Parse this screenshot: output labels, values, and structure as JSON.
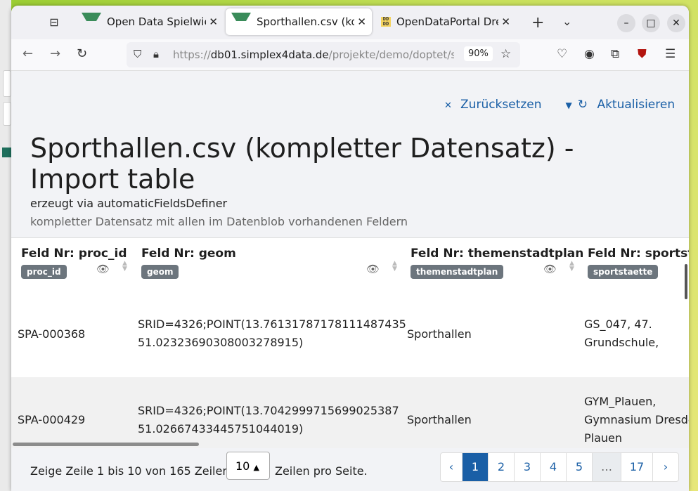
{
  "browser": {
    "tabs": [
      {
        "title": "Open Data Spielwiese",
        "icon": "green-triangle-favicon"
      },
      {
        "title": "Sporthallen.csv (kompl",
        "icon": "green-triangle-favicon"
      },
      {
        "title": "OpenDataPortal Dresd",
        "icon": "dd-favicon"
      }
    ],
    "url_prefix": "https://",
    "url_host": "db01.simplex4data.de",
    "url_path": "/projekte/demo/doptet/s",
    "zoom": "90%"
  },
  "page": {
    "actions": {
      "reset": "Zurücksetzen",
      "refresh": "Aktualisieren"
    },
    "title": "Sporthallen.csv (kompletter Datensatz) - Import table",
    "subtitle": "erzeugt via automaticFieldsDefiner",
    "description": "kompletter Datensatz mit allen im Datenblob vorhandenen Feldern"
  },
  "table": {
    "columns": [
      {
        "label": "Feld Nr: proc_id",
        "badge": "proc_id"
      },
      {
        "label": "Feld Nr: geom",
        "badge": "geom"
      },
      {
        "label": "Feld Nr: themenstadtplan",
        "badge": "themenstadtplan"
      },
      {
        "label": "Feld Nr: sportstae",
        "badge": "sportstaette"
      }
    ],
    "rows": [
      {
        "proc_id": "SPA-000368",
        "geom1": "SRID=4326;POINT(13.76131787178111487435",
        "geom2": "51.02323690308003278915)",
        "themen": "Sporthallen",
        "sport1": "GS_047, 47.",
        "sport2": "Grundschule,",
        "sport3": ""
      },
      {
        "proc_id": "SPA-000429",
        "geom1": "SRID=4326;POINT(13.7042999715699025387",
        "geom2": "51.02667433445751044019)",
        "themen": "Sporthallen",
        "sport1": "GYM_Plauen,",
        "sport2": "Gymnasium Dresde",
        "sport3": "Plauen"
      }
    ]
  },
  "footer": {
    "showing": "Zeige Zeile 1 bis 10 von 165 Zeilen.",
    "page_size": "10",
    "per_page": "Zeilen pro Seite.",
    "pages": [
      "‹",
      "1",
      "2",
      "3",
      "4",
      "5",
      "…",
      "17",
      "›"
    ]
  }
}
